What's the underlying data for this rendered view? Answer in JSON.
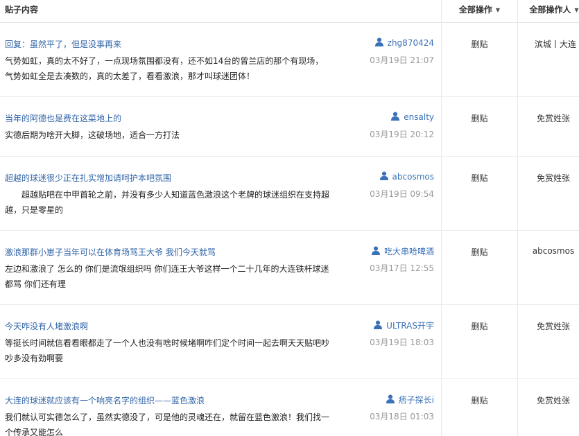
{
  "header": {
    "content_label": "贴子内容",
    "action_label": "全部操作",
    "operator_label": "全部操作人"
  },
  "icons": {
    "caret": "caret-down-icon",
    "user": "user-icon"
  },
  "colors": {
    "link": "#3366a8",
    "author": "#3a72b7",
    "muted": "#999999"
  },
  "posts": [
    {
      "title": "回复：虽然平了，但是没事再来",
      "author": "zhg870424",
      "time": "03月19日 21:07",
      "body": "气势如虹，真的太不好了，一点现场氛围都没有，还不如14台的曾兰店的那个有现场，气势如虹全是去凑数的，真的太差了，看看激浪，那才叫球迷团体！",
      "action": "删贴",
      "operator": "滨城丨大连"
    },
    {
      "title": "当年的阿德也是费在这菜地上的",
      "author": "ensalty",
      "time": "03月19日 20:12",
      "body": "实德后期为啥开大脚，这破场地，适合一方打法",
      "action": "删贴",
      "operator": "免赏姓张"
    },
    {
      "title": "超越的球迷很少正在扎实增加请呵护本吧氛围",
      "author": "abcosmos",
      "time": "03月19日 09:54",
      "body": "超越贴吧在中甲首轮之前，并没有多少人知道蓝色激浪这个老牌的球迷组织在支持超越，只是零星的",
      "action": "删贴",
      "operator": "免赏姓张"
    },
    {
      "title": "激浪那群小崽子当年可以在体育场骂王大爷 我们今天就骂",
      "author": "吃大串哈啤酒",
      "time": "03月17日 12:55",
      "body": "左边和激浪了 怎么的 你们是流氓组织吗 你们连王大爷这样一个二十几年的大连铁杆球迷都骂 你们还有理",
      "action": "删贴",
      "operator": "abcosmos"
    },
    {
      "title": "今天咋没有人堵激浪啊",
      "author": "ULTRAS开宇",
      "time": "03月19日 18:03",
      "body": "等挺长时间就信看看眼都走了一个人也没有啥时候堵啊咋们定个时间一起去啊天天贴吧吵吵多没有劲啊要",
      "action": "删贴",
      "operator": "免赏姓张"
    },
    {
      "title": "大连的球迷就应该有一个响亮名字的组织——蓝色激浪",
      "author": "痞子探长i",
      "time": "03月18日 01:03",
      "body": "我们就认可实德怎么了，虽然实德没了，可是他的灵魂还在，就留在蓝色激浪！我们找一个传承又能怎么",
      "action": "删贴",
      "operator": "免赏姓张"
    }
  ]
}
